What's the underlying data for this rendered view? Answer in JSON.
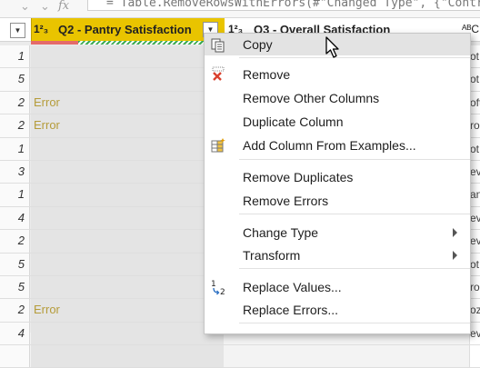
{
  "formula_bar": {
    "text": "= Table.RemoveRowsWithErrors(#\"Changed Type\", {\"Contr"
  },
  "columns": {
    "selected": {
      "type_label": "1²₃",
      "title": "Q2 - Pantry Satisfaction",
      "color": "#e9c400"
    },
    "next": {
      "type_label": "1²₃",
      "title": "Q3 - Overall Satisfaction"
    },
    "partial": {
      "type_label": "ᴬᴮC"
    }
  },
  "quality": {
    "error_color": "#e46a6a",
    "valid_color": "#3cab54"
  },
  "rows": [
    {
      "num": "1",
      "cell": "",
      "right": "ot"
    },
    {
      "num": "5",
      "cell": "",
      "right": "ot"
    },
    {
      "num": "2",
      "cell": "Error",
      "right": "oft"
    },
    {
      "num": "2",
      "cell": "Error",
      "right": "roz"
    },
    {
      "num": "1",
      "cell": "",
      "right": "ot"
    },
    {
      "num": "3",
      "cell": "",
      "right": "ev"
    },
    {
      "num": "1",
      "cell": "",
      "right": "an"
    },
    {
      "num": "4",
      "cell": "",
      "right": "ev"
    },
    {
      "num": "2",
      "cell": "",
      "right": "ev"
    },
    {
      "num": "5",
      "cell": "",
      "right": "ot"
    },
    {
      "num": "5",
      "cell": "",
      "right": "roz"
    },
    {
      "num": "2",
      "cell": "Error",
      "right": "oz"
    },
    {
      "num": "4",
      "cell": "",
      "right": "ev"
    },
    {
      "num": "",
      "cell": "",
      "right": ""
    }
  ],
  "context_menu": {
    "items": [
      {
        "label": "Copy",
        "icon": "copy-icon"
      },
      {
        "label": "Remove",
        "icon": "remove-icon"
      },
      {
        "label": "Remove Other Columns",
        "icon": ""
      },
      {
        "label": "Duplicate Column",
        "icon": ""
      },
      {
        "label": "Add Column From Examples...",
        "icon": "add-column-examples-icon"
      },
      {
        "label": "Remove Duplicates",
        "icon": ""
      },
      {
        "label": "Remove Errors",
        "icon": ""
      },
      {
        "label": "Change Type",
        "icon": "",
        "submenu": true
      },
      {
        "label": "Transform",
        "icon": "",
        "submenu": true
      },
      {
        "label": "Replace Values...",
        "icon": "replace-values-icon"
      },
      {
        "label": "Replace Errors...",
        "icon": ""
      }
    ]
  }
}
